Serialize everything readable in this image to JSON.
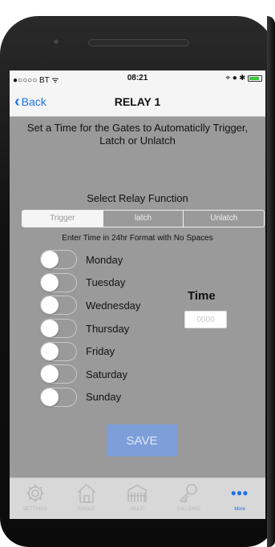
{
  "status_bar": {
    "carrier": "●○○○○ BT ᯤ",
    "time": "08:21",
    "indicators": "⌖ ● ✱"
  },
  "nav": {
    "back_label": "Back",
    "title": "RELAY 1"
  },
  "intro_text": "Set a Time for the Gates to Automaticlly Trigger, Latch or Unlatch",
  "relay_function": {
    "heading": "Select Relay Function",
    "options": [
      "Trigger",
      "latch",
      "Unlatch"
    ],
    "selected": "Trigger"
  },
  "format_hint": "Enter Time in 24hr Format with No Spaces",
  "days": [
    {
      "label": "Monday",
      "on": false
    },
    {
      "label": "Tuesday",
      "on": false
    },
    {
      "label": "Wednesday",
      "on": false
    },
    {
      "label": "Thursday",
      "on": false
    },
    {
      "label": "Friday",
      "on": false
    },
    {
      "label": "Saturday",
      "on": false
    },
    {
      "label": "Sunday",
      "on": false
    }
  ],
  "time": {
    "label": "Time",
    "value": "",
    "placeholder": "0000"
  },
  "save_label": "SAVE",
  "tab_bar": {
    "tabs": [
      {
        "label": "SETTINGS",
        "icon": "gear-icon"
      },
      {
        "label": "SINGLE",
        "icon": "house-icon"
      },
      {
        "label": "MULTI",
        "icon": "gate-icon"
      },
      {
        "label": "CALLERID",
        "icon": "key-icon"
      },
      {
        "label": "More",
        "icon": "more-icon"
      }
    ],
    "active": "More"
  },
  "colors": {
    "screen_bg": "#9a9a9a",
    "accent": "#1a73e8",
    "save_bg": "#7d9ed8"
  }
}
